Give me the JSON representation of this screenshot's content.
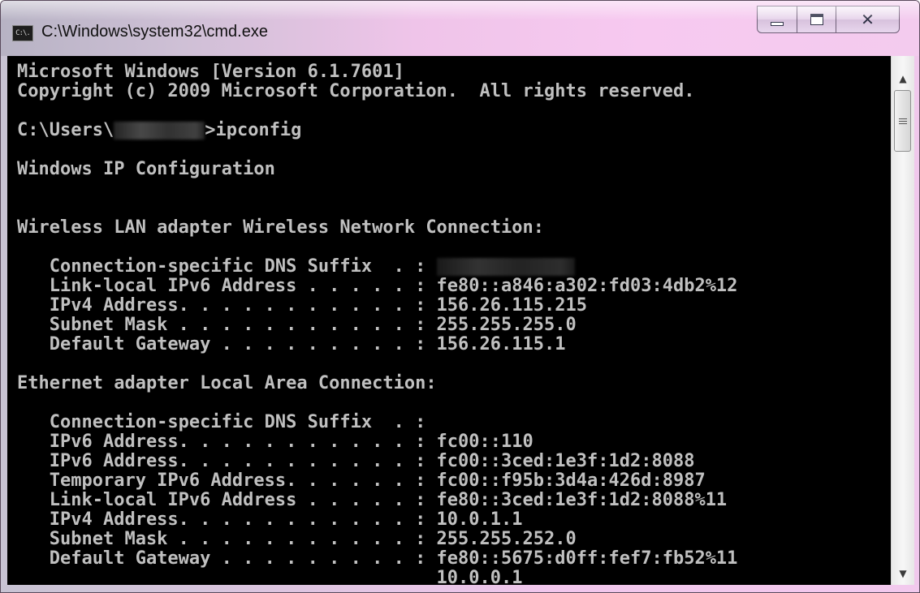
{
  "window": {
    "title": "C:\\Windows\\system32\\cmd.exe",
    "icon_text": "C:\\."
  },
  "controls": {
    "minimize": "minimize",
    "maximize": "maximize",
    "close": "close"
  },
  "console": {
    "lines": [
      {
        "text": "Microsoft Windows [Version 6.1.7601]",
        "row": 0
      },
      {
        "text": "Copyright (c) 2009 Microsoft Corporation.  All rights reserved.",
        "row": 1
      },
      {
        "text": "C:\\Users\\",
        "row": 3,
        "redacted": true,
        "suffix": ">ipconfig"
      },
      {
        "text": "Windows IP Configuration",
        "row": 5
      },
      {
        "text": "Wireless LAN adapter Wireless Network Connection:",
        "row": 8
      },
      {
        "text": "   Connection-specific DNS Suffix  . : ",
        "row": 10,
        "redacted_value": true
      },
      {
        "text": "   Link-local IPv6 Address . . . . . : fe80::a846:a302:fd03:4db2%12",
        "row": 11
      },
      {
        "text": "   IPv4 Address. . . . . . . . . . . : 156.26.115.215",
        "row": 12
      },
      {
        "text": "   Subnet Mask . . . . . . . . . . . : 255.255.255.0",
        "row": 13
      },
      {
        "text": "   Default Gateway . . . . . . . . . : 156.26.115.1",
        "row": 14
      },
      {
        "text": "Ethernet adapter Local Area Connection:",
        "row": 16
      },
      {
        "text": "   Connection-specific DNS Suffix  . :",
        "row": 18
      },
      {
        "text": "   IPv6 Address. . . . . . . . . . . : fc00::110",
        "row": 19
      },
      {
        "text": "   IPv6 Address. . . . . . . . . . . : fc00::3ced:1e3f:1d2:8088",
        "row": 20
      },
      {
        "text": "   Temporary IPv6 Address. . . . . . : fc00::f95b:3d4a:426d:8987",
        "row": 21
      },
      {
        "text": "   Link-local IPv6 Address . . . . . : fe80::3ced:1e3f:1d2:8088%11",
        "row": 22
      },
      {
        "text": "   IPv4 Address. . . . . . . . . . . : 10.0.1.1",
        "row": 23
      },
      {
        "text": "   Subnet Mask . . . . . . . . . . . : 255.255.252.0",
        "row": 24
      },
      {
        "text": "   Default Gateway . . . . . . . . . : fe80::5675:d0ff:fef7:fb52%11",
        "row": 25
      },
      {
        "text": "                                       10.0.0.1",
        "row": 26
      }
    ]
  },
  "scrollbar": {
    "up_arrow": "▲",
    "down_arrow": "▼"
  },
  "colors": {
    "console_bg": "#000000",
    "console_text": "#c0c0c0"
  }
}
